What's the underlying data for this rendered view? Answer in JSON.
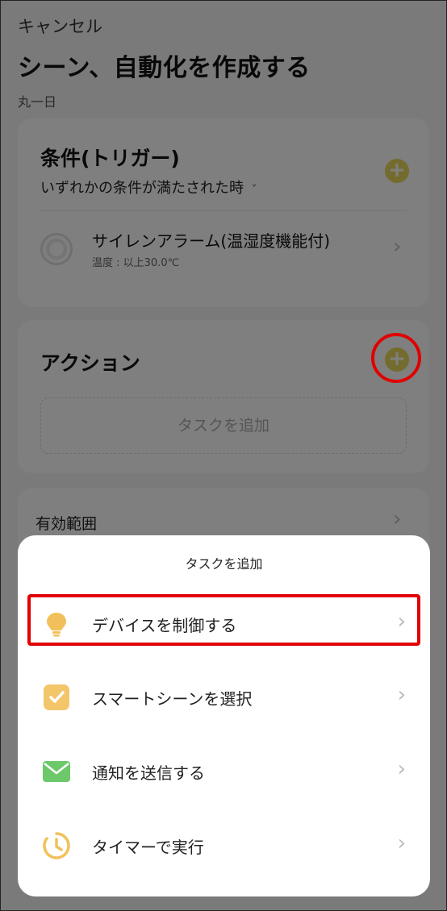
{
  "header": {
    "cancel_label": "キャンセル",
    "title": "シーン、自動化を作成する",
    "schedule": "丸一日"
  },
  "trigger_card": {
    "title": "条件(トリガー)",
    "mode": "いずれかの条件が満たされた時",
    "mode_chevron": "˅",
    "device": {
      "name": "サイレンアラーム(温湿度機能付)",
      "condition": "温度 : 以上30.0℃"
    }
  },
  "action_card": {
    "title": "アクション",
    "add_task_placeholder": "タスクを追加"
  },
  "scope_card": {
    "label": "有効範囲"
  },
  "sheet": {
    "title": "タスクを追加",
    "items": [
      {
        "label": "デバイスを制御する",
        "icon": "lightbulb-icon"
      },
      {
        "label": "スマートシーンを選択",
        "icon": "checkbox-icon"
      },
      {
        "label": "通知を送信する",
        "icon": "envelope-icon"
      },
      {
        "label": "タイマーで実行",
        "icon": "clock-icon"
      }
    ]
  },
  "glyphs": {
    "plus": "+",
    "chevron": "›"
  },
  "colors": {
    "accent_yellow": "#e9d95c",
    "highlight_red": "#e00000",
    "bulb": "#f2c05a",
    "check_tile": "#f4c66a",
    "mail": "#6cc86a"
  }
}
